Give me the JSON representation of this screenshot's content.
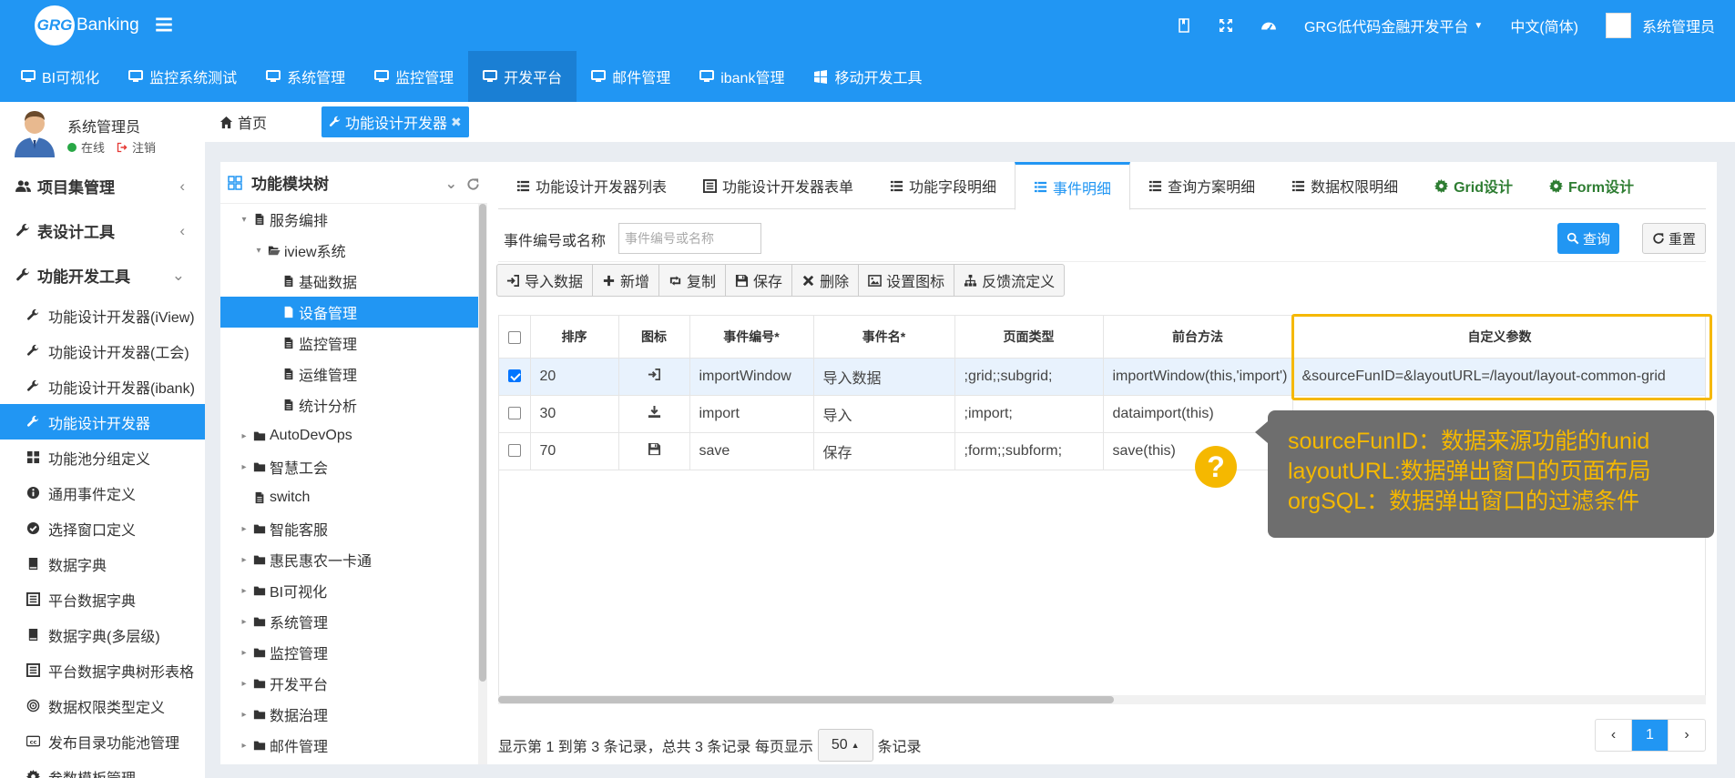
{
  "header": {
    "logo_mark": "GRG",
    "logo_text": "Banking",
    "platform_menu": "GRG低代码金融开发平台",
    "language": "中文(简体)",
    "user": "系统管理员"
  },
  "main_nav": [
    {
      "label": "BI可视化",
      "icon": "monitor-icon"
    },
    {
      "label": "监控系统测试",
      "icon": "monitor-icon"
    },
    {
      "label": "系统管理",
      "icon": "monitor-icon"
    },
    {
      "label": "监控管理",
      "icon": "monitor-icon"
    },
    {
      "label": "开发平台",
      "icon": "monitor-icon",
      "active": true
    },
    {
      "label": "邮件管理",
      "icon": "monitor-icon"
    },
    {
      "label": "ibank管理",
      "icon": "monitor-icon"
    },
    {
      "label": "移动开发工具",
      "icon": "windows-icon"
    }
  ],
  "sidebar": {
    "user_name": "系统管理员",
    "status_online": "在线",
    "logout": "注销",
    "groups": [
      {
        "label": "项目集管理",
        "arrow": "‹"
      },
      {
        "label": "表设计工具",
        "arrow": "‹"
      },
      {
        "label": "功能开发工具",
        "arrow": "⌄"
      }
    ],
    "items": [
      {
        "label": "功能设计开发器(iView)",
        "icon": "wrench-icon"
      },
      {
        "label": "功能设计开发器(工会)",
        "icon": "wrench-icon"
      },
      {
        "label": "功能设计开发器(ibank)",
        "icon": "wrench-icon"
      },
      {
        "label": "功能设计开发器",
        "icon": "wrench-icon",
        "active": true
      },
      {
        "label": "功能池分组定义",
        "icon": "grid-icon"
      },
      {
        "label": "通用事件定义",
        "icon": "info-circle-icon"
      },
      {
        "label": "选择窗口定义",
        "icon": "check-circle-icon"
      },
      {
        "label": "数据字典",
        "icon": "book-icon"
      },
      {
        "label": "平台数据字典",
        "icon": "list-alt-icon"
      },
      {
        "label": "数据字典(多层级)",
        "icon": "book-icon"
      },
      {
        "label": "平台数据字典树形表格",
        "icon": "list-alt-icon"
      },
      {
        "label": "数据权限类型定义",
        "icon": "target-icon"
      },
      {
        "label": "发布目录功能池管理",
        "icon": "cc-icon"
      },
      {
        "label": "参数模板管理",
        "icon": "gear-icon"
      }
    ]
  },
  "tabs": {
    "home": "首页",
    "current": "功能设计开发器"
  },
  "tree": {
    "title": "功能模块树",
    "nodes": [
      {
        "label": "服务编排",
        "level": 0,
        "toggle": "▾",
        "icon": "file-icon"
      },
      {
        "label": "iview系统",
        "level": 1,
        "toggle": "▾",
        "icon": "folder-open-icon"
      },
      {
        "label": "基础数据",
        "level": 2,
        "toggle": "",
        "icon": "file-icon"
      },
      {
        "label": "设备管理",
        "level": 2,
        "toggle": "",
        "icon": "file-icon",
        "selected": true
      },
      {
        "label": "监控管理",
        "level": 2,
        "toggle": "",
        "icon": "file-icon"
      },
      {
        "label": "运维管理",
        "level": 2,
        "toggle": "",
        "icon": "file-icon"
      },
      {
        "label": "统计分析",
        "level": 2,
        "toggle": "",
        "icon": "file-icon"
      },
      {
        "label": "AutoDevOps",
        "level": 0,
        "toggle": "▸",
        "icon": "folder-icon"
      },
      {
        "label": "智慧工会",
        "level": 0,
        "toggle": "▸",
        "icon": "folder-icon"
      },
      {
        "label": "switch",
        "level": 0,
        "toggle": "",
        "icon": "file-icon"
      },
      {
        "label": "智能客服",
        "level": 0,
        "toggle": "▸",
        "icon": "folder-icon"
      },
      {
        "label": "惠民惠农一卡通",
        "level": 0,
        "toggle": "▸",
        "icon": "folder-icon"
      },
      {
        "label": "BI可视化",
        "level": 0,
        "toggle": "▸",
        "icon": "folder-icon"
      },
      {
        "label": "系统管理",
        "level": 0,
        "toggle": "▸",
        "icon": "folder-icon"
      },
      {
        "label": "监控管理",
        "level": 0,
        "toggle": "▸",
        "icon": "folder-icon"
      },
      {
        "label": "开发平台",
        "level": 0,
        "toggle": "▸",
        "icon": "folder-icon"
      },
      {
        "label": "数据治理",
        "level": 0,
        "toggle": "▸",
        "icon": "folder-icon"
      },
      {
        "label": "邮件管理",
        "level": 0,
        "toggle": "▸",
        "icon": "folder-icon"
      }
    ]
  },
  "detail_tabs": [
    {
      "label": "功能设计开发器列表",
      "icon": "list-icon"
    },
    {
      "label": "功能设计开发器表单",
      "icon": "list-alt-icon"
    },
    {
      "label": "功能字段明细",
      "icon": "list-icon"
    },
    {
      "label": "事件明细",
      "icon": "list-icon",
      "active": true
    },
    {
      "label": "查询方案明细",
      "icon": "list-icon"
    },
    {
      "label": "数据权限明细",
      "icon": "list-icon"
    },
    {
      "label": "Grid设计",
      "icon": "gear-icon",
      "green": true
    },
    {
      "label": "Form设计",
      "icon": "gear-icon",
      "green": true
    }
  ],
  "filter": {
    "label": "事件编号或名称",
    "placeholder": "事件编号或名称",
    "search": "查询",
    "reset": "重置"
  },
  "toolbar": [
    {
      "label": "导入数据",
      "icon": "sign-in-icon"
    },
    {
      "label": "新增",
      "icon": "plus-icon"
    },
    {
      "label": "复制",
      "icon": "retweet-icon"
    },
    {
      "label": "保存",
      "icon": "save-icon"
    },
    {
      "label": "删除",
      "icon": "times-icon"
    },
    {
      "label": "设置图标",
      "icon": "picture-icon"
    },
    {
      "label": "反馈流定义",
      "icon": "sitemap-icon"
    }
  ],
  "grid": {
    "columns": [
      "排序",
      "图标",
      "事件编号*",
      "事件名*",
      "页面类型",
      "前台方法",
      "自定义参数"
    ],
    "rows": [
      {
        "checked": true,
        "order": "20",
        "icon": "sign-in-icon",
        "code": "importWindow",
        "name": "导入数据",
        "page_type": ";grid;;subgrid;",
        "method": "importWindow(this,'import')",
        "params": "&sourceFunID=&layoutURL=/layout/layout-common-grid"
      },
      {
        "checked": false,
        "order": "30",
        "icon": "download-icon",
        "code": "import",
        "name": "导入",
        "page_type": ";import;",
        "method": "dataimport(this)",
        "params": ""
      },
      {
        "checked": false,
        "order": "70",
        "icon": "save-icon",
        "code": "save",
        "name": "保存",
        "page_type": ";form;;subform;",
        "method": "save(this)",
        "params": ""
      }
    ]
  },
  "footer": {
    "summary": "显示第 1 到第 3 条记录，总共 3 条记录 每页显示",
    "page_size": "50",
    "suffix": "条记录",
    "prev": "‹",
    "current_page": "1",
    "next": "›"
  },
  "tooltip": {
    "lines": [
      "sourceFunID：数据来源功能的funid",
      "layoutURL:数据弹出窗口的页面布局",
      "orgSQL：数据弹出窗口的过滤条件"
    ],
    "marker": "?"
  },
  "colors": {
    "primary": "#2196f3",
    "highlight": "#f5b800",
    "tooltip_bg": "#6e6e6e",
    "green_tab": "#2e7d32"
  }
}
